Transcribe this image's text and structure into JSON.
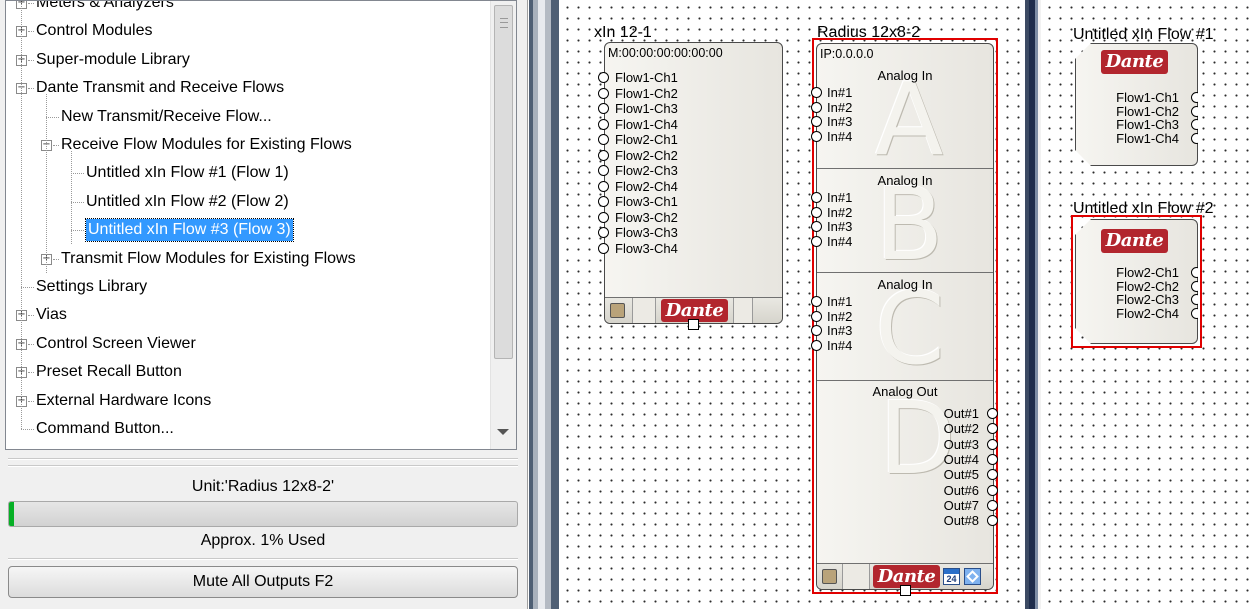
{
  "tree": {
    "items": [
      {
        "label": "Meters & Analyzers",
        "state": "collapsed"
      },
      {
        "label": "Control Modules",
        "state": "collapsed"
      },
      {
        "label": "Super-module Library",
        "state": "collapsed"
      },
      {
        "label": "Dante Transmit and Receive Flows",
        "state": "expanded"
      },
      {
        "label": "New Transmit/Receive Flow...",
        "state": "leaf"
      },
      {
        "label": "Receive Flow Modules for Existing Flows",
        "state": "expanded"
      },
      {
        "label": "Untitled xIn Flow #1 (Flow 1)",
        "state": "leaf"
      },
      {
        "label": "Untitled xIn Flow #2 (Flow 2)",
        "state": "leaf"
      },
      {
        "label": "Untitled xIn Flow #3 (Flow 3)",
        "state": "selected"
      },
      {
        "label": "Transmit Flow Modules for Existing Flows",
        "state": "collapsed"
      },
      {
        "label": "Settings Library",
        "state": "leaf"
      },
      {
        "label": "Vias",
        "state": "collapsed"
      },
      {
        "label": "Control Screen Viewer",
        "state": "collapsed"
      },
      {
        "label": "Preset Recall Button",
        "state": "collapsed"
      },
      {
        "label": "External Hardware Icons",
        "state": "collapsed"
      },
      {
        "label": "Command Button...",
        "state": "leaf"
      }
    ]
  },
  "status": {
    "unit_label": "Unit:'Radius 12x8-2'",
    "usage_label": "Approx.  1% Used",
    "usage_percent": 1,
    "mute_button": "Mute All Outputs  F2"
  },
  "canvas": {
    "xin_module": {
      "title": "xIn 12-1",
      "mac": "M:00:00:00:00:00:00",
      "channels": [
        "Flow1-Ch1",
        "Flow1-Ch2",
        "Flow1-Ch3",
        "Flow1-Ch4",
        "Flow2-Ch1",
        "Flow2-Ch2",
        "Flow2-Ch3",
        "Flow2-Ch4",
        "Flow3-Ch1",
        "Flow3-Ch2",
        "Flow3-Ch3",
        "Flow3-Ch4"
      ],
      "brand": "Dante"
    },
    "radius_module": {
      "title": "Radius 12x8-2",
      "ip": "IP:0.0.0.0",
      "cards": [
        {
          "title": "Analog In",
          "letter": "A",
          "ports": [
            "In#1",
            "In#2",
            "In#3",
            "In#4"
          ]
        },
        {
          "title": "Analog In",
          "letter": "B",
          "ports": [
            "In#1",
            "In#2",
            "In#3",
            "In#4"
          ]
        },
        {
          "title": "Analog In",
          "letter": "C",
          "ports": [
            "In#1",
            "In#2",
            "In#3",
            "In#4"
          ]
        },
        {
          "title": "Analog Out",
          "letter": "D",
          "ports": [
            "Out#1",
            "Out#2",
            "Out#3",
            "Out#4",
            "Out#5",
            "Out#6",
            "Out#7",
            "Out#8"
          ]
        }
      ],
      "brand": "Dante",
      "calendar_num": "24"
    },
    "flow1": {
      "title": "Untitled xIn Flow #1",
      "brand": "Dante",
      "channels": [
        "Flow1-Ch1",
        "Flow1-Ch2",
        "Flow1-Ch3",
        "Flow1-Ch4"
      ]
    },
    "flow2": {
      "title": "Untitled xIn Flow #2",
      "brand": "Dante",
      "channels": [
        "Flow2-Ch1",
        "Flow2-Ch2",
        "Flow2-Ch3",
        "Flow2-Ch4"
      ]
    }
  },
  "colors": {
    "selection": "#3399ff",
    "dante_red": "#b2262e",
    "highlight_border": "#e00000",
    "progress_green": "#06b025"
  }
}
